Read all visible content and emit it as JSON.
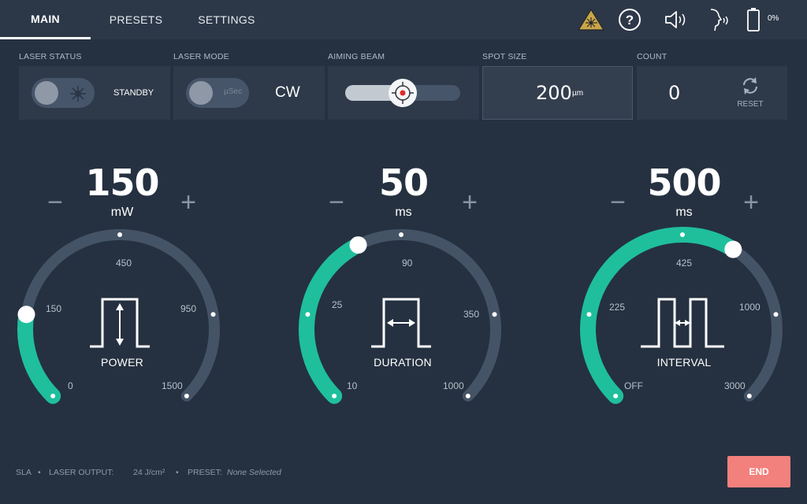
{
  "tabs": [
    {
      "label": "MAIN",
      "active": true
    },
    {
      "label": "PRESETS",
      "active": false
    },
    {
      "label": "SETTINGS",
      "active": false
    }
  ],
  "topbar": {
    "battery_percent_text": "0%",
    "battery_level": 0,
    "icons": [
      "laser-warning-icon",
      "help-icon",
      "speaker-icon",
      "voice-icon",
      "battery-icon"
    ]
  },
  "status": {
    "laser_status_label": "LASER STATUS",
    "laser_status_value": "STANDBY",
    "laser_mode_label": "LASER MODE",
    "laser_mode_toggle_text": "µSec",
    "laser_mode_value": "CW",
    "aiming_beam_label": "AIMING BEAM",
    "aiming_beam_level": 0.5,
    "spot_size_label": "SPOT SIZE",
    "spot_size_value": "200",
    "spot_size_unit": "µm",
    "count_label": "COUNT",
    "count_value": "0",
    "reset_label": "RESET"
  },
  "gauges": {
    "power": {
      "value": "150",
      "unit": "mW",
      "name": "POWER",
      "minus": "−",
      "plus": "+",
      "ticks": {
        "t0": "0",
        "t1": "150",
        "t2": "450",
        "t3": "950",
        "t4": "1500"
      },
      "fill_fraction": 0.2
    },
    "duration": {
      "value": "50",
      "unit": "ms",
      "name": "DURATION",
      "minus": "−",
      "plus": "+",
      "ticks": {
        "t0": "10",
        "t1": "25",
        "t2": "90",
        "t3": "350",
        "t4": "1000"
      },
      "fill_fraction": 0.4
    },
    "interval": {
      "value": "500",
      "unit": "ms",
      "name": "INTERVAL",
      "minus": "−",
      "plus": "+",
      "ticks": {
        "t0": "OFF",
        "t1": "225",
        "t2": "425",
        "t3": "1000",
        "t4": "3000"
      },
      "fill_fraction": 0.62
    }
  },
  "footer": {
    "sla": "SLA",
    "laser_output_label": "LASER OUTPUT:",
    "laser_output_value": "24 J/cm²",
    "preset_label": "PRESET:",
    "preset_value": "None Selected",
    "end_label": "END"
  },
  "colors": {
    "accent": "#1fbf9c",
    "track": "#455366",
    "end_button": "#f2807d",
    "background": "#253140"
  }
}
